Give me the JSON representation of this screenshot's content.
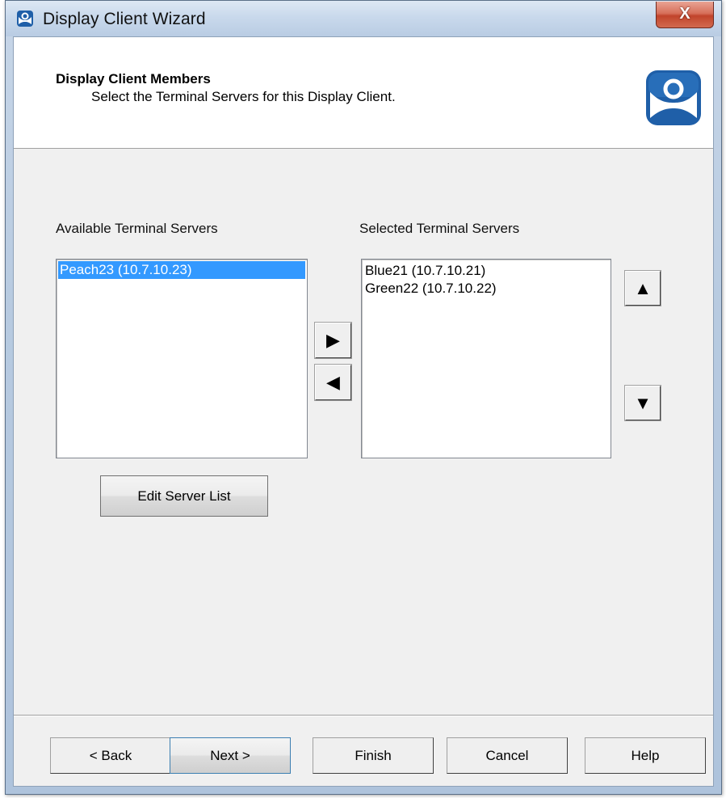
{
  "window": {
    "title": "Display Client Wizard",
    "close_glyph": "X"
  },
  "header": {
    "title": "Display Client Members",
    "subtitle": "Select the Terminal Servers for this Display Client."
  },
  "available": {
    "label": "Available Terminal Servers",
    "items": [
      "Peach23 (10.7.10.23)"
    ],
    "selected_index": 0
  },
  "selected": {
    "label": "Selected Terminal Servers",
    "items": [
      "Blue21 (10.7.10.21)",
      "Green22 (10.7.10.22)"
    ]
  },
  "buttons": {
    "edit_server_list": "Edit Server List",
    "add_glyph": "▶",
    "remove_glyph": "◀",
    "move_up_glyph": "▲",
    "move_down_glyph": "▼"
  },
  "footer": {
    "back": "< Back",
    "next": "Next >",
    "finish": "Finish",
    "cancel": "Cancel",
    "help": "Help"
  },
  "colors": {
    "selection": "#3399ff",
    "close_button": "#c1442b",
    "logo_blue": "#1f5fa8"
  }
}
